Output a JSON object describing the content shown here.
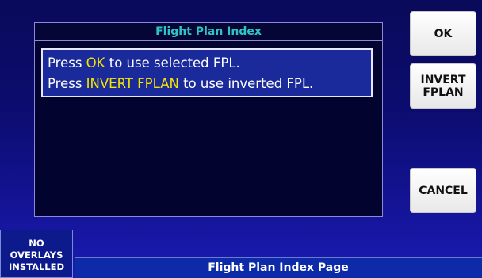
{
  "panel": {
    "title": "Flight Plan Index",
    "line1": {
      "pre": "Press ",
      "key": "OK",
      "post": " to use selected FPL."
    },
    "line2": {
      "pre": "Press ",
      "key": "INVERT FPLAN",
      "post": " to use inverted FPL."
    }
  },
  "buttons": {
    "ok": "OK",
    "invert_line1": "INVERT",
    "invert_line2": "FPLAN",
    "cancel": "CANCEL"
  },
  "overlay": {
    "line1": "NO",
    "line2": "OVERLAYS",
    "line3": "INSTALLED"
  },
  "status_bar": {
    "label": "Flight Plan Index Page"
  },
  "colors": {
    "title_text": "#2ec4c4",
    "highlight_text": "#f5e400",
    "selection_bg": "#1a2a9a"
  }
}
